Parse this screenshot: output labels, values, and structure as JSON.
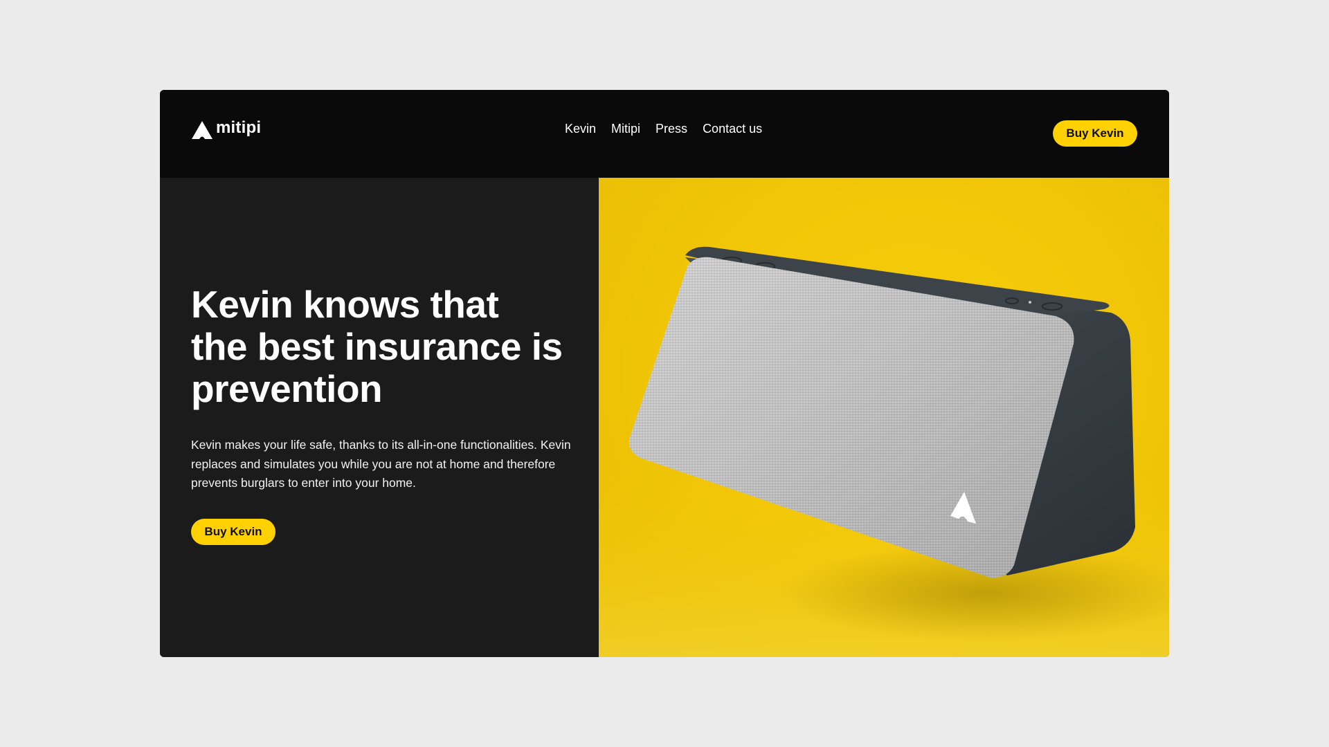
{
  "brand": {
    "name": "mitipi",
    "icon": "mitipi-triangle-logo-icon"
  },
  "nav": {
    "links": [
      "Kevin",
      "Mitipi",
      "Press",
      "Contact us"
    ],
    "cta_label": "Buy Kevin"
  },
  "hero": {
    "headline": "Kevin knows that the best insurance is prevention",
    "body": "Kevin makes your life safe, thanks to its all-in-one functionalities. Kevin replaces and simulates you while you are not at home and therefore prevents burglars to enter into your home.",
    "cta_label": "Buy Kevin",
    "image": "kevin-device-product-photo"
  },
  "colors": {
    "accent": "#ffd100",
    "navbar": "#0a0a0a",
    "hero_left": "#1b1b1b",
    "hero_right": "#f2c707",
    "page_bg": "#ebebeb"
  }
}
